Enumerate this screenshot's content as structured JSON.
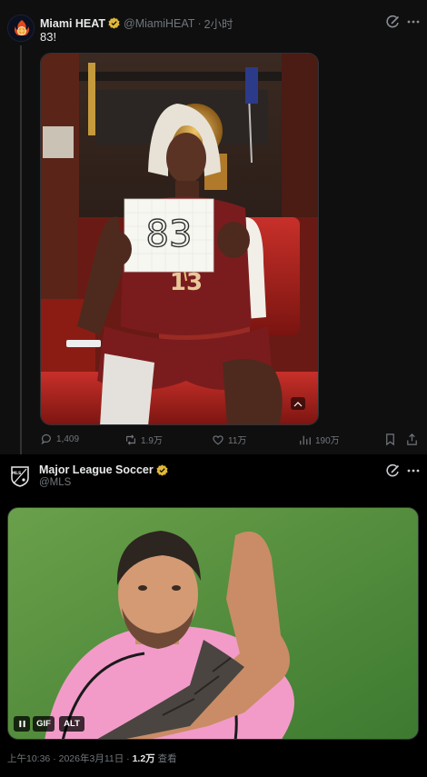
{
  "colors": {
    "verified": "#e0b83a",
    "secondary_text": "#71767b",
    "accent": "#1d9bf0"
  },
  "tweet1": {
    "author": "Miami HEAT",
    "handle": "@MiamiHEAT",
    "separator": "·",
    "time": "2小时",
    "text": "83!",
    "media_text": {
      "sign": "83",
      "jersey": "13"
    },
    "stats": {
      "replies": "1,409",
      "reposts": "1.9万",
      "likes": "11万",
      "views": "190万"
    },
    "icons": [
      "grok-icon",
      "more-icon",
      "reply-icon",
      "repost-icon",
      "like-icon",
      "views-icon",
      "bookmark-icon",
      "share-icon",
      "media-badge-icon"
    ]
  },
  "tweet2": {
    "author": "Major League Soccer",
    "handle": "@MLS",
    "avatar_label": "MLS",
    "media_controls": {
      "gif": "GIF",
      "alt": "ALT"
    },
    "meta": {
      "time": "上午10:36",
      "separator": "·",
      "date": "2026年3月11日",
      "separator2": "·",
      "views_count": "1.2万",
      "views_label": "查看"
    },
    "icons": [
      "grok-icon",
      "more-icon",
      "pause-icon"
    ]
  }
}
